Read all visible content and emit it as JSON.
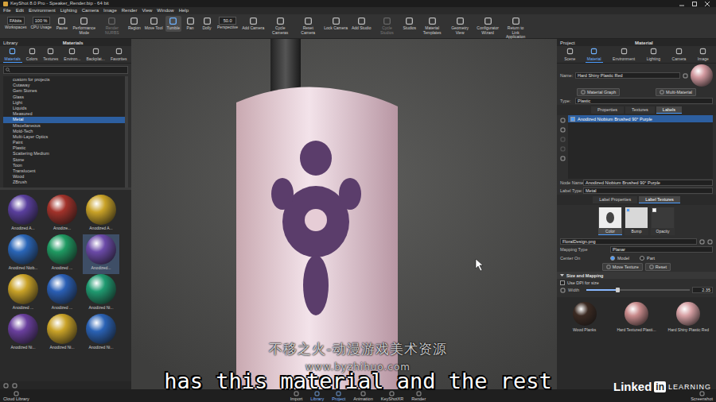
{
  "title_bar": {
    "title": "KeyShot 8.0 Pro - Speaker_Render.bip - 64 bit"
  },
  "menu": [
    "File",
    "Edit",
    "Environment",
    "Lighting",
    "Camera",
    "Image",
    "Render",
    "View",
    "Window",
    "Help"
  ],
  "toolbar": [
    {
      "kind": "field",
      "field": "FAbits",
      "label": "Workspaces",
      "active": false,
      "disabled": false
    },
    {
      "kind": "field",
      "field": "100 %",
      "label": "CPU Usage",
      "active": false,
      "disabled": false
    },
    {
      "kind": "icon",
      "label": "Pause",
      "active": false,
      "disabled": false
    },
    {
      "kind": "icon",
      "label": "Performance Mode",
      "active": false,
      "disabled": false
    },
    {
      "kind": "icon",
      "label": "Render NURBS",
      "active": false,
      "disabled": true
    },
    {
      "kind": "icon",
      "label": "Region",
      "active": false,
      "disabled": false
    },
    {
      "kind": "icon",
      "label": "Move Tool",
      "active": false,
      "disabled": false
    },
    {
      "kind": "icon",
      "label": "Tumble",
      "active": true,
      "disabled": false
    },
    {
      "kind": "icon",
      "label": "Pan",
      "active": false,
      "disabled": false
    },
    {
      "kind": "icon",
      "label": "Dolly",
      "active": false,
      "disabled": false
    },
    {
      "kind": "field",
      "field": "50.0",
      "label": "Perspective",
      "active": false,
      "disabled": false
    },
    {
      "kind": "icon",
      "label": "Add Camera",
      "active": false,
      "disabled": false
    },
    {
      "kind": "icon",
      "label": "Cycle Cameras",
      "active": false,
      "disabled": false
    },
    {
      "kind": "icon",
      "label": "Reset Camera",
      "active": false,
      "disabled": false
    },
    {
      "kind": "icon",
      "label": "Lock Camera",
      "active": false,
      "disabled": false
    },
    {
      "kind": "icon",
      "label": "Add Studio",
      "active": false,
      "disabled": false
    },
    {
      "kind": "icon",
      "label": "Cycle Studios",
      "active": false,
      "disabled": true
    },
    {
      "kind": "icon",
      "label": "Studios",
      "active": false,
      "disabled": false
    },
    {
      "kind": "icon",
      "label": "Material Templates",
      "active": false,
      "disabled": false
    },
    {
      "kind": "icon",
      "label": "Geometry View",
      "active": false,
      "disabled": false
    },
    {
      "kind": "icon",
      "label": "Configurator Wizard",
      "active": false,
      "disabled": false
    },
    {
      "kind": "icon",
      "label": "Return to Link Application",
      "active": false,
      "disabled": false
    }
  ],
  "left_panel": {
    "header": "Library",
    "title": "Materials",
    "tabs": [
      {
        "label": "Materials",
        "selected": true
      },
      {
        "label": "Colors",
        "selected": false
      },
      {
        "label": "Textures",
        "selected": false
      },
      {
        "label": "Environ...",
        "selected": false
      },
      {
        "label": "Backplat...",
        "selected": false
      },
      {
        "label": "Favorites",
        "selected": false
      }
    ],
    "tree": [
      {
        "label": "custom for projects",
        "selected": false
      },
      {
        "label": "Cutaway",
        "selected": false
      },
      {
        "label": "Gem Stones",
        "selected": false
      },
      {
        "label": "Glass",
        "selected": false
      },
      {
        "label": "Light",
        "selected": false
      },
      {
        "label": "Liquids",
        "selected": false
      },
      {
        "label": "Measured",
        "selected": false
      },
      {
        "label": "Metal",
        "selected": true
      },
      {
        "label": "Miscellaneous",
        "selected": false
      },
      {
        "label": "Mold-Tech",
        "selected": false
      },
      {
        "label": "Multi-Layer Optics",
        "selected": false
      },
      {
        "label": "Paint",
        "selected": false
      },
      {
        "label": "Plastic",
        "selected": false
      },
      {
        "label": "Scattering Medium",
        "selected": false
      },
      {
        "label": "Stone",
        "selected": false
      },
      {
        "label": "Toon",
        "selected": false
      },
      {
        "label": "Translucent",
        "selected": false
      },
      {
        "label": "Wood",
        "selected": false
      },
      {
        "label": "ZBrush",
        "selected": false
      }
    ],
    "thumbnails": [
      {
        "label": "Anodized A...",
        "color": "#5a3f9e",
        "selected": false
      },
      {
        "label": "Anodize...",
        "color": "#a2322a",
        "selected": false
      },
      {
        "label": "Anodized A...",
        "color": "#c9a227",
        "selected": false
      },
      {
        "label": "Anodized Niob...",
        "color": "#2a66b8",
        "selected": false
      },
      {
        "label": "Anodized ...",
        "color": "#1f9a62",
        "selected": false
      },
      {
        "label": "Anodized...",
        "color": "#6b4aa8",
        "selected": true
      },
      {
        "label": "Anodized ...",
        "color": "#c9a227",
        "selected": false
      },
      {
        "label": "Anodized ...",
        "color": "#2a5fb5",
        "selected": false
      },
      {
        "label": "Anodized Ni...",
        "color": "#1f9a70",
        "selected": false
      },
      {
        "label": "Anodized Ni...",
        "color": "#6a3f9e",
        "selected": false
      },
      {
        "label": "Anodized Ni...",
        "color": "#c9a227",
        "selected": false
      },
      {
        "label": "Anodized Ni...",
        "color": "#2a62b5",
        "selected": false
      }
    ]
  },
  "right_panel": {
    "header": "Project",
    "title": "Material",
    "tabs": [
      {
        "label": "Scene",
        "selected": false
      },
      {
        "label": "Material",
        "selected": true
      },
      {
        "label": "Environment",
        "selected": false
      },
      {
        "label": "Lighting",
        "selected": false
      },
      {
        "label": "Camera",
        "selected": false
      },
      {
        "label": "Image",
        "selected": false
      }
    ],
    "name_label": "Name:",
    "name_value": "Hard Shiny Plastic Red",
    "buttons": [
      "Material Graph",
      "Multi-Material"
    ],
    "type_label": "Type:",
    "type_value": "Plastic",
    "subtabs": [
      {
        "label": "Properties",
        "selected": false
      },
      {
        "label": "Textures",
        "selected": false
      },
      {
        "label": "Labels",
        "selected": true
      }
    ],
    "labels": [
      {
        "label": "Anodized Niobium Brushed 90° Purple",
        "checked": true,
        "selected": true
      }
    ],
    "node_name_label": "Node Name:",
    "node_name_value": "Anodized Niobium Brushed 90° Purple",
    "label_type_label": "Label Type:",
    "label_type_value": "Metal",
    "label_tabs": [
      {
        "label": "Label Properties",
        "selected": false
      },
      {
        "label": "Label Textures",
        "selected": true
      }
    ],
    "texture_slots": [
      {
        "label": "Color",
        "selected": true,
        "kind": "image",
        "checked": false
      },
      {
        "label": "Bump",
        "selected": false,
        "kind": "check",
        "checked": true
      },
      {
        "label": "Opacity",
        "selected": false,
        "kind": "check",
        "checked": false
      }
    ],
    "file": "FloralDesign.png",
    "mapping_label": "Mapping Type",
    "mapping_value": "Planar",
    "center_label": "Center On",
    "center_options": [
      {
        "label": "Model",
        "selected": true
      },
      {
        "label": "Part",
        "selected": false
      }
    ],
    "actions": [
      "Move Texture",
      "Reset"
    ],
    "section": "Size and Mapping",
    "dpi": {
      "label": "Use DPI for size",
      "checked": false
    },
    "width": {
      "label": "Width",
      "value": "2.35",
      "level": 0.3
    },
    "swatches": [
      {
        "label": "Wood Planks",
        "color": "#3b2a22"
      },
      {
        "label": "Hard Textured Plasti...",
        "color": "#c98b8c"
      },
      {
        "label": "Hard Shiny Plastic Red",
        "color": "#d7a0a4"
      }
    ]
  },
  "bottom_bar": {
    "left": "Cloud Library",
    "items": [
      {
        "label": "Import",
        "selected": false
      },
      {
        "label": "Library",
        "selected": true
      },
      {
        "label": "Project",
        "selected": true
      },
      {
        "label": "Animation",
        "selected": false
      },
      {
        "label": "KeyShotXR",
        "selected": false
      },
      {
        "label": "Render",
        "selected": false
      }
    ],
    "right": "Screenshot"
  },
  "overlay": {
    "watermark": [
      "不移之火-动漫游戏美术资源",
      "www.byzhihuo.com"
    ],
    "subtitle": "has this material and the rest",
    "brand": {
      "name": "Linked",
      "box": "in",
      "suffix": "LEARNING"
    }
  }
}
